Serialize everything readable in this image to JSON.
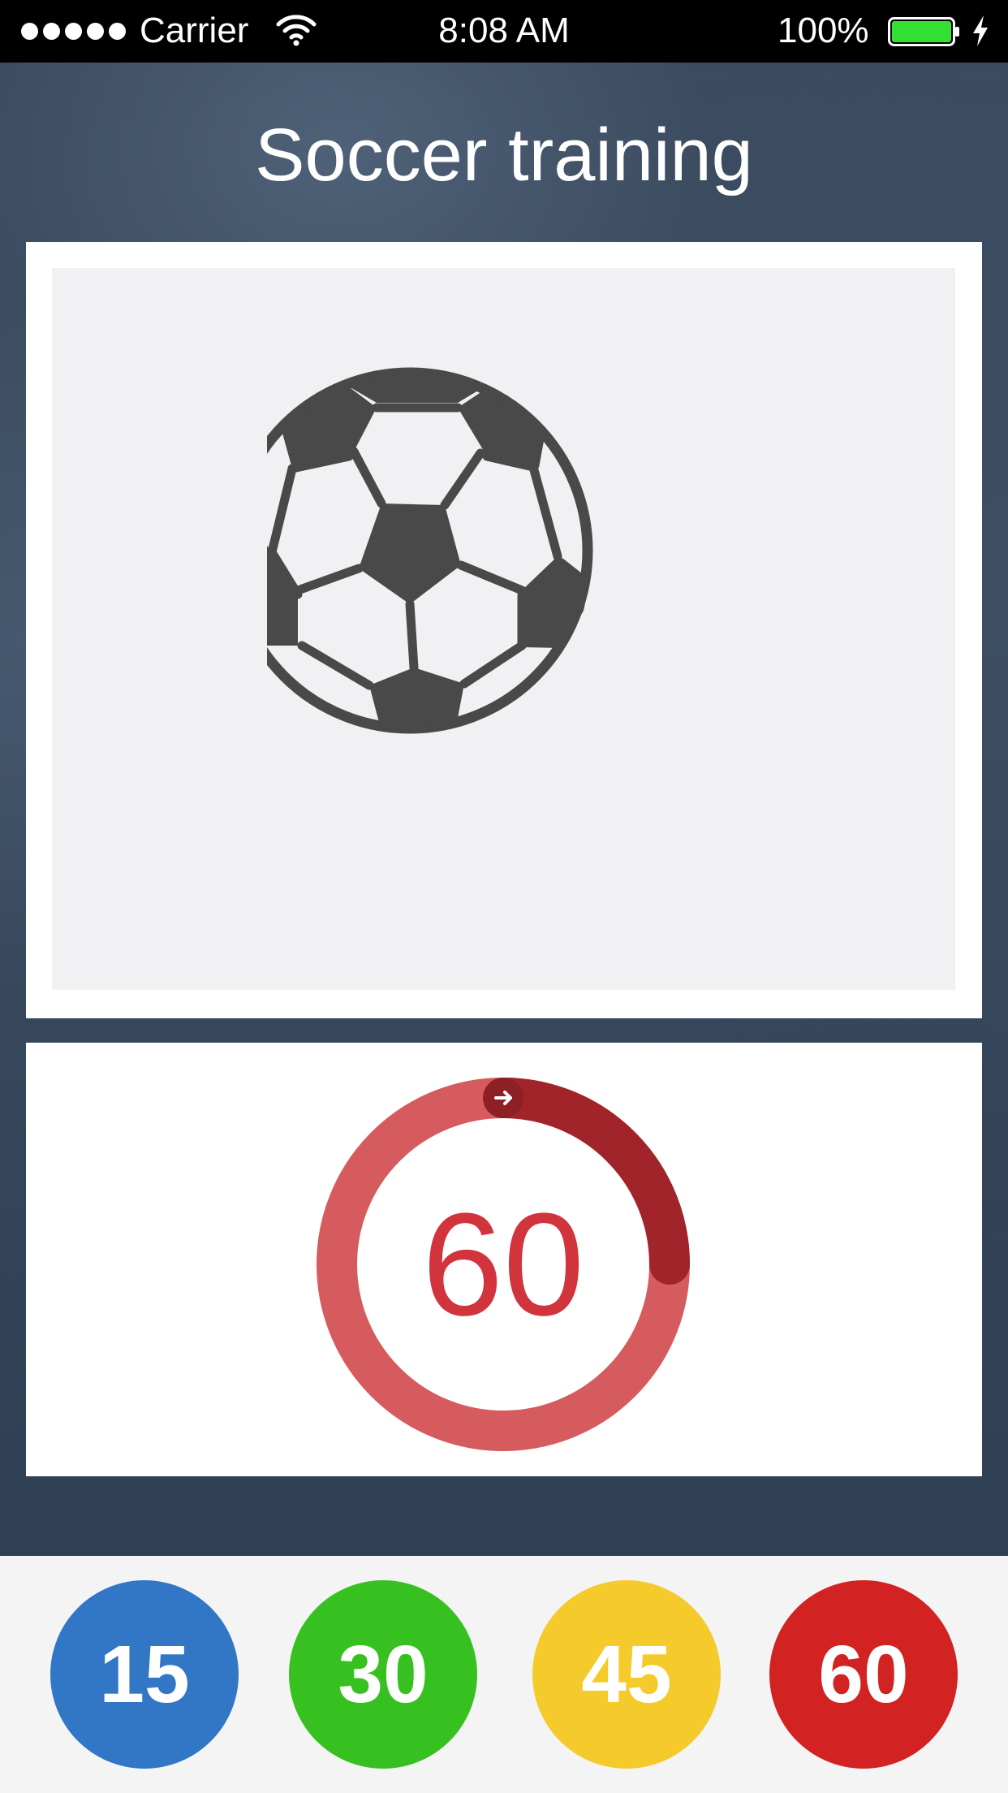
{
  "status_bar": {
    "carrier": "Carrier",
    "time": "8:08 AM",
    "battery": "100%",
    "icons": [
      "signal-dots-icon",
      "wifi-icon",
      "battery-icon",
      "charging-icon"
    ]
  },
  "title": "Soccer training",
  "image_card": {
    "icon": "soccer-ball-icon"
  },
  "timer": {
    "value": "60",
    "progress": 0.25,
    "icon": "arrow-right-icon"
  },
  "presets": [
    {
      "label": "15",
      "color": "#3277c6"
    },
    {
      "label": "30",
      "color": "#37c120"
    },
    {
      "label": "45",
      "color": "#f5ca2b"
    },
    {
      "label": "60",
      "color": "#d22222"
    }
  ],
  "colors": {
    "background": "#3a4a5e",
    "timer_ring": "#d65b5e",
    "timer_arc": "#a0242a",
    "timer_text": "#d1343c",
    "ball": "#494949",
    "battery": "#33e033"
  }
}
